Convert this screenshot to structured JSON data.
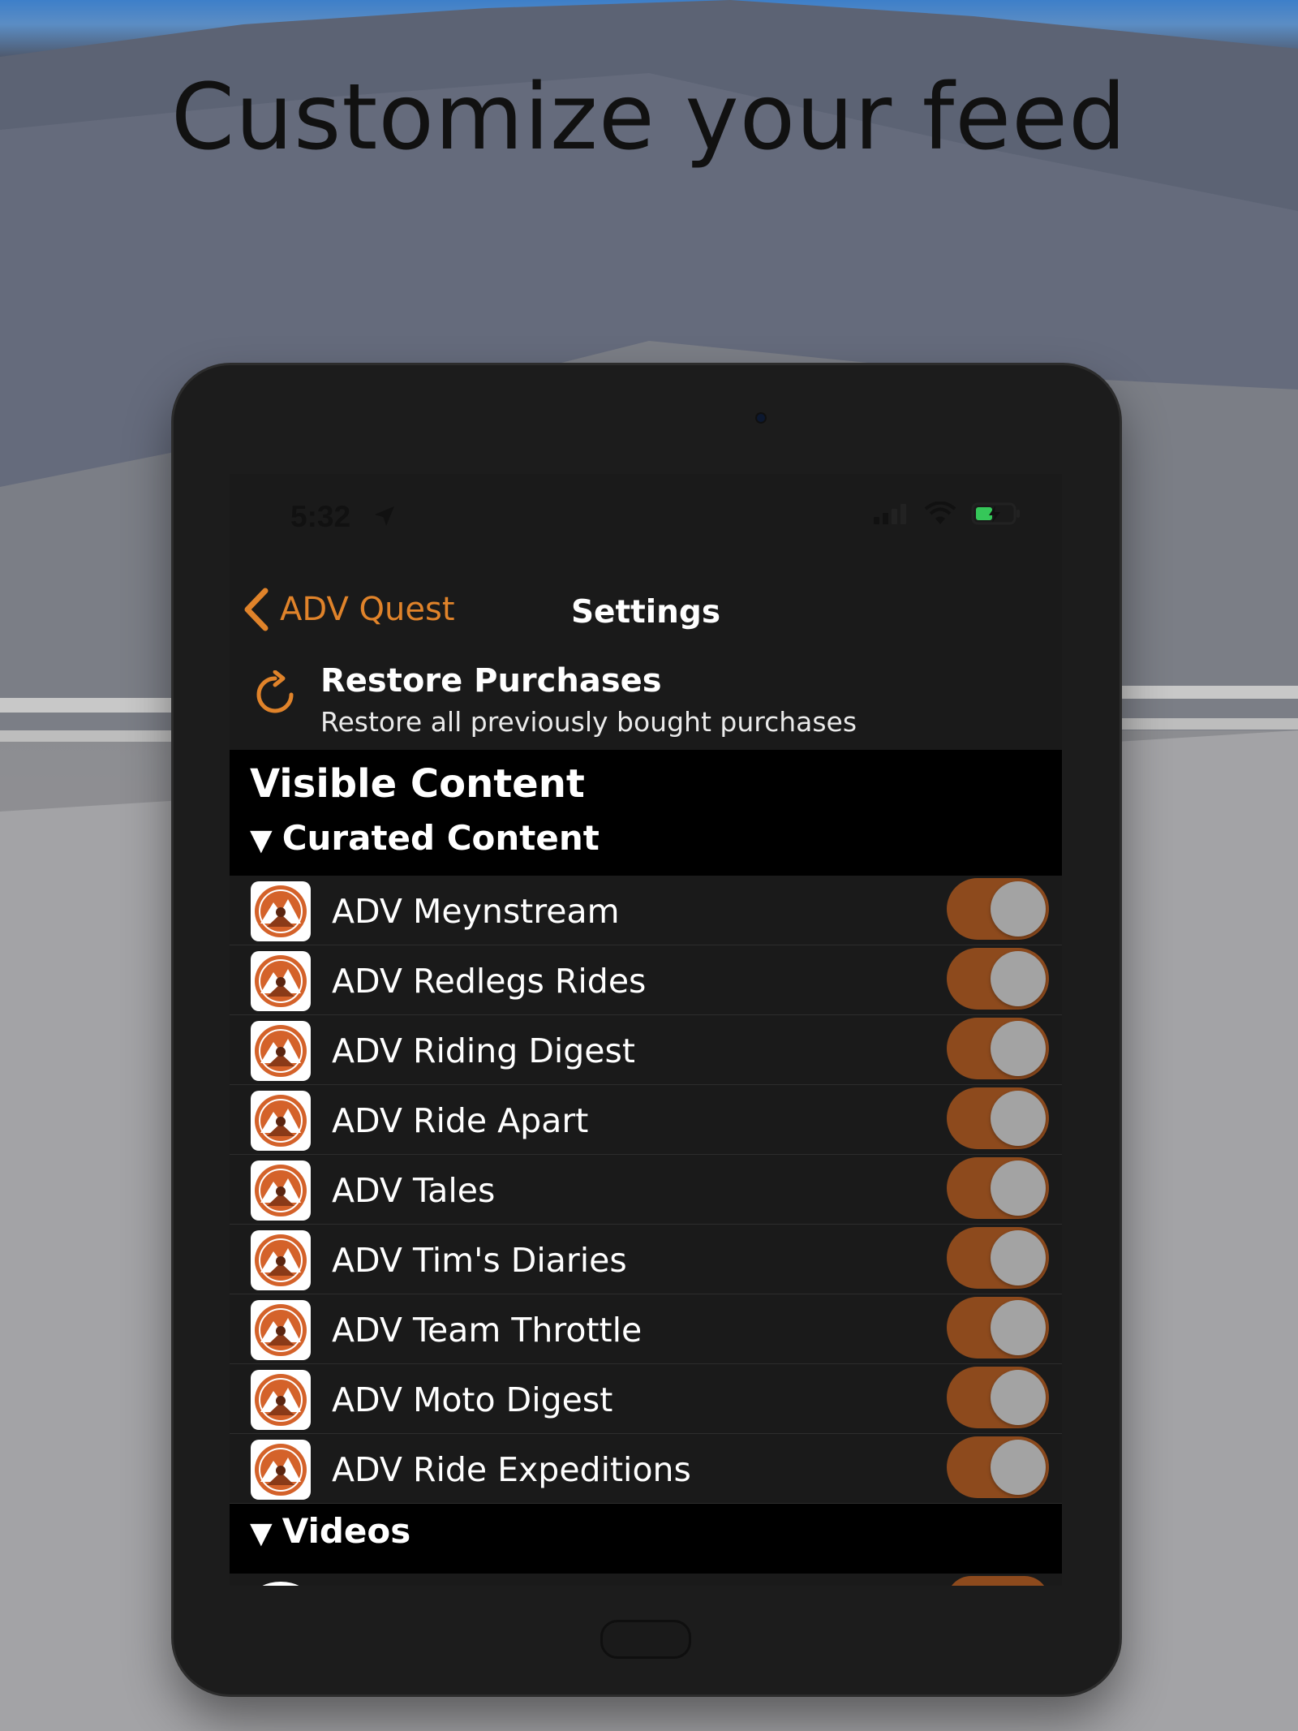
{
  "headline": "Customize your feed",
  "status_bar": {
    "time": "5:32"
  },
  "nav": {
    "back_label": "ADV Quest",
    "title": "Settings"
  },
  "restore": {
    "title": "Restore Purchases",
    "subtitle": "Restore all previously bought purchases"
  },
  "section_title": "Visible Content",
  "groups": [
    {
      "label": "Curated Content"
    },
    {
      "label": "Videos"
    }
  ],
  "curated_items": [
    {
      "name": "ADV Meynstream",
      "enabled": true
    },
    {
      "name": "ADV Redlegs Rides",
      "enabled": true
    },
    {
      "name": "ADV Riding Digest",
      "enabled": true
    },
    {
      "name": "ADV Ride Apart",
      "enabled": true
    },
    {
      "name": "ADV Tales",
      "enabled": true
    },
    {
      "name": "ADV Tim's Diaries",
      "enabled": true
    },
    {
      "name": "ADV Team Throttle",
      "enabled": true
    },
    {
      "name": "ADV Moto Digest",
      "enabled": true
    },
    {
      "name": "ADV Ride Expeditions",
      "enabled": true
    }
  ],
  "colors": {
    "accent": "#e0832a",
    "toggle_on": "#8d4a1d",
    "logo_orange": "#d4622a"
  },
  "icons": [
    "location-arrow-icon",
    "signal-icon",
    "wifi-icon",
    "battery-icon",
    "chevron-left-icon",
    "refresh-icon",
    "disclosure-triangle-icon",
    "adv-logo-icon"
  ]
}
